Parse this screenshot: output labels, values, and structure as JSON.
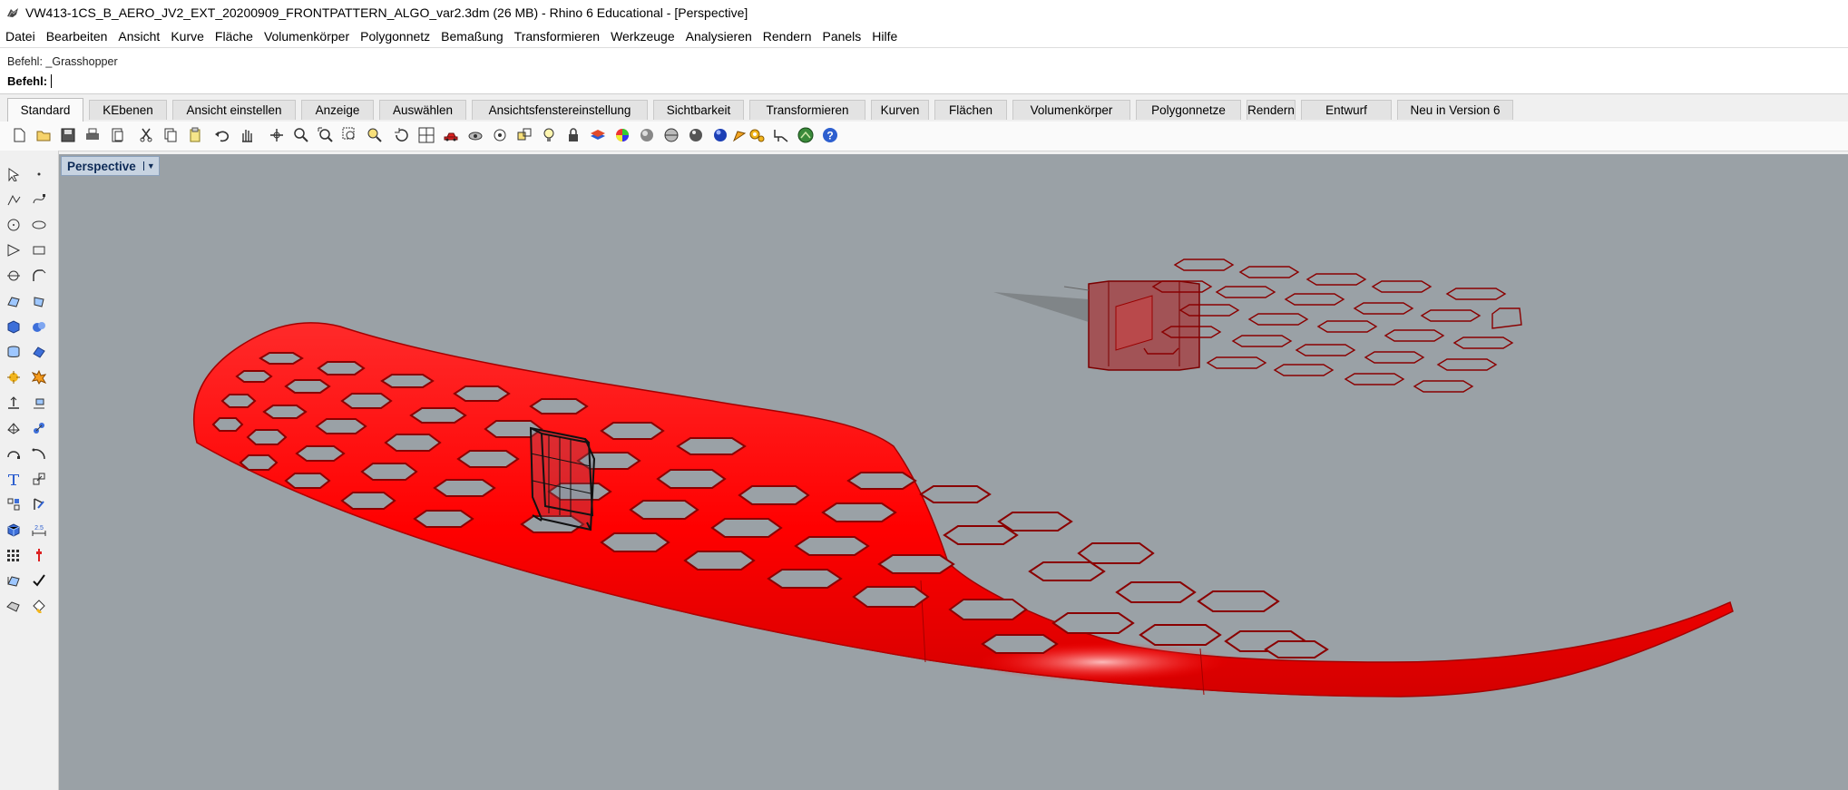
{
  "window": {
    "title": "VW413-1CS_B_AERO_JV2_EXT_20200909_FRONTPATTERN_ALGO_var2.3dm (26 MB) - Rhino 6 Educational - [Perspective]"
  },
  "menu": [
    "Datei",
    "Bearbeiten",
    "Ansicht",
    "Kurve",
    "Fläche",
    "Volumenkörper",
    "Polygonnetz",
    "Bemaßung",
    "Transformieren",
    "Werkzeuge",
    "Analysieren",
    "Rendern",
    "Panels",
    "Hilfe"
  ],
  "command": {
    "history_line_1": "Befehl: _Grasshopper",
    "prompt_label": "Befehl:",
    "input_value": ""
  },
  "tabs": [
    "Standard",
    "KEbenen",
    "Ansicht einstellen",
    "Anzeige",
    "Auswählen",
    "Ansichtsfenstereinstellung",
    "Sichtbarkeit",
    "Transformieren",
    "Kurven",
    "Flächen",
    "Volumenkörper",
    "Polygonnetze",
    "Rendern",
    "Entwurf",
    "Neu in Version 6"
  ],
  "active_tab": "Standard",
  "toolbar_icons": [
    "new-file-icon",
    "open-folder-icon",
    "save-icon",
    "print-icon",
    "copy-to-clipboard-icon",
    "cut-icon",
    "copy-icon",
    "paste-icon",
    "undo-icon",
    "pan-hand-icon",
    "rotate-view-icon",
    "zoom-icon",
    "zoom-extents-icon",
    "zoom-window-icon",
    "zoom-selected-icon",
    "rotate-icon",
    "four-viewports-icon",
    "car-icon",
    "named-view-icon",
    "properties-icon",
    "object-snap-icon",
    "light-bulb-icon",
    "lock-icon",
    "layer-icon",
    "color-wheel-icon",
    "render-shaded-icon",
    "render-sphere-icon",
    "render-ball-icon",
    "pen-drafting-icon",
    "gears-icon",
    "join-icon",
    "grasshopper-icon",
    "help-icon"
  ],
  "left_tools": [
    "select-icon",
    "point-icon",
    "polyline-icon",
    "curve-icon",
    "circle-icon",
    "ellipse-icon",
    "polygon-icon",
    "rectangle-icon",
    "fillet-icon",
    "offset-icon",
    "surface-icon",
    "loft-icon",
    "box-solid-icon",
    "boolean-icon",
    "extrude-icon",
    "surface-edit-icon",
    "transform-icon",
    "explode-icon",
    "move-icon",
    "align-icon",
    "mesh-icon",
    "mesh-edit-icon",
    "blend-icon",
    "arc-icon",
    "text-icon",
    "scale-icon",
    "group-icon",
    "gumball-icon",
    "block-icon",
    "dimension-icon",
    "array-icon",
    "cplane-icon",
    "analyze-icon",
    "check-icon",
    "render-icon",
    "paint-icon"
  ],
  "viewport": {
    "name": "Perspective",
    "background": "#9aa1a6",
    "model_color": "#ff0000"
  }
}
